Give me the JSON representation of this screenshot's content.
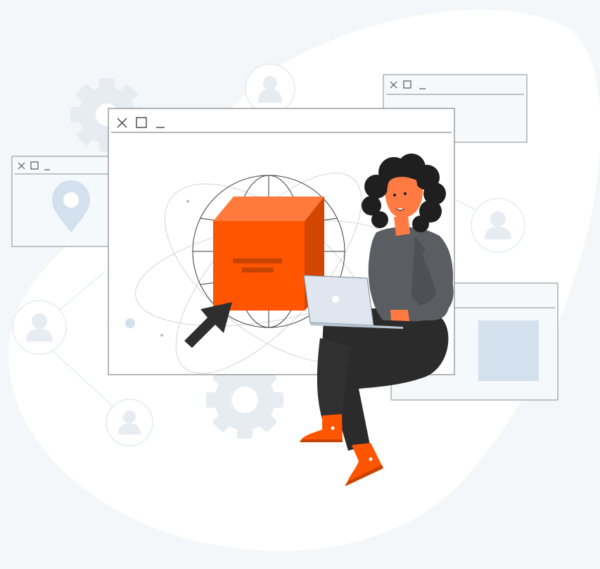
{
  "illustration": {
    "theme": "person with laptop browsing application windows around a globe and a 3D box",
    "colors": {
      "background": "#f3f7fa",
      "blob": "#ffffff",
      "window_border": "#6e6e6e",
      "window_fill": "#ffffff",
      "muted_blue": "#d3e0ee",
      "light_gray": "#e6ecf1",
      "box_front": "#ff5400",
      "box_top": "#ff7a3c",
      "box_side": "#d34600",
      "hair": "#1f1f1f",
      "skin": "#ff7b43",
      "shirt": "#5a5d61",
      "pants": "#2b2b2b",
      "laptop": "#dfe6ef",
      "cursor": "#2e2e2e"
    },
    "icons": [
      "gear-icon",
      "user-icon",
      "location-pin-icon",
      "globe-icon",
      "box-icon",
      "cursor-arrow-icon",
      "laptop-icon",
      "close-icon",
      "maximize-icon",
      "minimize-icon"
    ]
  }
}
